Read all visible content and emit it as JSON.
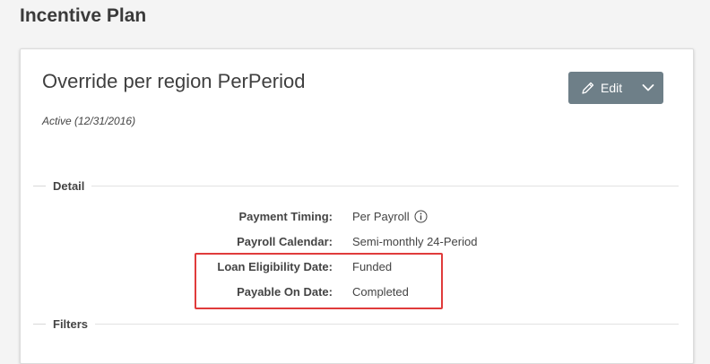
{
  "page": {
    "title": "Incentive Plan"
  },
  "plan": {
    "title": "Override per region PerPeriod",
    "status": "Active (12/31/2016)"
  },
  "actions": {
    "edit_label": "Edit"
  },
  "sections": {
    "detail": "Detail",
    "filters": "Filters"
  },
  "details": [
    {
      "label": "Payment Timing:",
      "value": "Per Payroll",
      "icon": "info-icon"
    },
    {
      "label": "Payroll Calendar:",
      "value": "Semi-monthly 24-Period"
    },
    {
      "label": "Loan Eligibility Date:",
      "value": "Funded"
    },
    {
      "label": "Payable On Date:",
      "value": "Completed"
    }
  ],
  "colors": {
    "button_bg": "#6e7f88",
    "highlight": "#e03b3b"
  }
}
